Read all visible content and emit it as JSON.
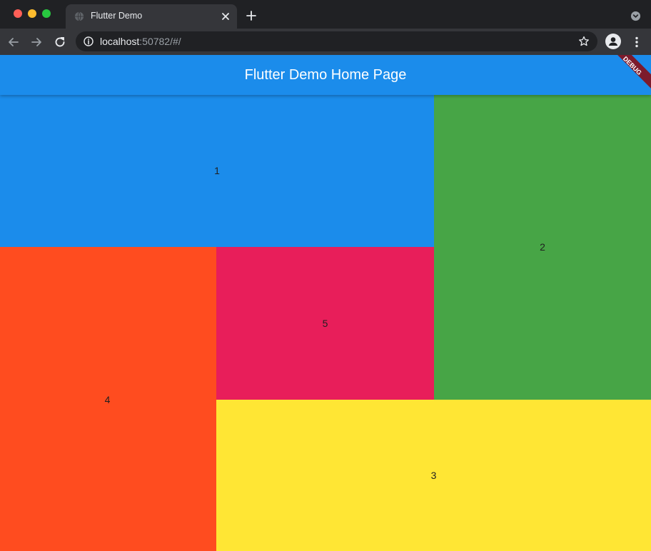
{
  "browser": {
    "tab": {
      "title": "Flutter Demo",
      "favicon": "globe-icon"
    },
    "address_bar": {
      "host": "localhost",
      "rest": ":50782/#/"
    },
    "icons": {
      "back": "arrow-left-icon",
      "forward": "arrow-right-icon",
      "reload": "reload-icon",
      "info": "info-icon",
      "bookmark": "star-icon",
      "profile": "profile-icon",
      "menu": "kebab-menu-icon"
    }
  },
  "app": {
    "title": "Flutter Demo Home Page",
    "debug_banner": "DEBUG",
    "tiles": [
      {
        "label": "1",
        "color": "#1b8ceb"
      },
      {
        "label": "2",
        "color": "#47a546"
      },
      {
        "label": "3",
        "color": "#ffe634"
      },
      {
        "label": "4",
        "color": "#ff4c1f"
      },
      {
        "label": "5",
        "color": "#e81e5a"
      }
    ]
  },
  "colors": {
    "chrome_dark": "#202124",
    "chrome_toolbar": "#35363a",
    "appbar": "#1b8ceb",
    "debug_banner": "#7c1b2c"
  }
}
